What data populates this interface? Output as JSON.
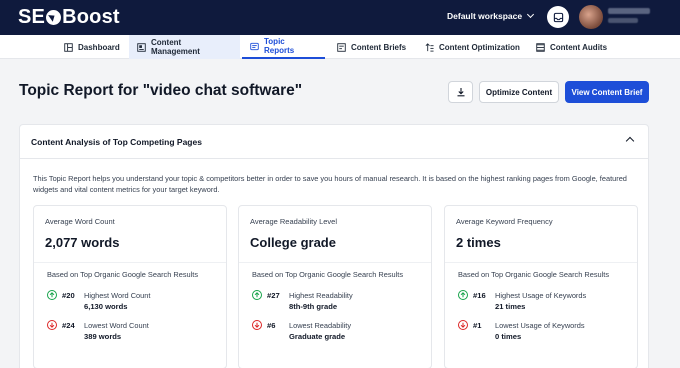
{
  "app": {
    "logo_left": "SE",
    "logo_right": "Boost",
    "workspace": "Default workspace"
  },
  "nav": {
    "tabs": [
      {
        "label": "Dashboard",
        "icon": "dashboard-icon"
      },
      {
        "label": "Content Management",
        "icon": "content-management-icon"
      },
      {
        "label": "Topic Reports",
        "icon": "topic-reports-icon"
      },
      {
        "label": "Content Briefs",
        "icon": "content-briefs-icon"
      },
      {
        "label": "Content Optimization",
        "icon": "content-optimization-icon"
      },
      {
        "label": "Content Audits",
        "icon": "content-audits-icon"
      }
    ]
  },
  "page": {
    "title": "Topic Report for \"video chat software\"",
    "optimize_label": "Optimize Content",
    "view_brief_label": "View Content Brief"
  },
  "panel": {
    "title": "Content Analysis of Top Competing Pages",
    "intro": "This Topic Report helps you understand your topic & competitors better in order to save you hours of manual research. It is based on the highest ranking pages from Google, featured widgets and vital content metrics for your target keyword."
  },
  "cards": [
    {
      "label": "Average Word Count",
      "value": "2,077 words",
      "basis": "Based on Top Organic Google Search Results",
      "high": {
        "rank": "#20",
        "desc": "Highest Word Count",
        "num": "6,130 words"
      },
      "low": {
        "rank": "#24",
        "desc": "Lowest Word Count",
        "num": "389 words"
      }
    },
    {
      "label": "Average Readability Level",
      "value": "College grade",
      "basis": "Based on Top Organic Google Search Results",
      "high": {
        "rank": "#27",
        "desc": "Highest Readability",
        "num": "8th-9th grade"
      },
      "low": {
        "rank": "#6",
        "desc": "Lowest Readability",
        "num": "Graduate grade"
      }
    },
    {
      "label": "Average Keyword Frequency",
      "value": "2 times",
      "basis": "Based on Top Organic Google Search Results",
      "high": {
        "rank": "#16",
        "desc": "Highest Usage of Keywords",
        "num": "21 times"
      },
      "low": {
        "rank": "#1",
        "desc": "Lowest Usage of Keywords",
        "num": "0 times"
      }
    }
  ],
  "colors": {
    "topbar": "#0f1a3d",
    "accent": "#1d4ed8",
    "up": "#16a34a",
    "down": "#dc2626"
  }
}
